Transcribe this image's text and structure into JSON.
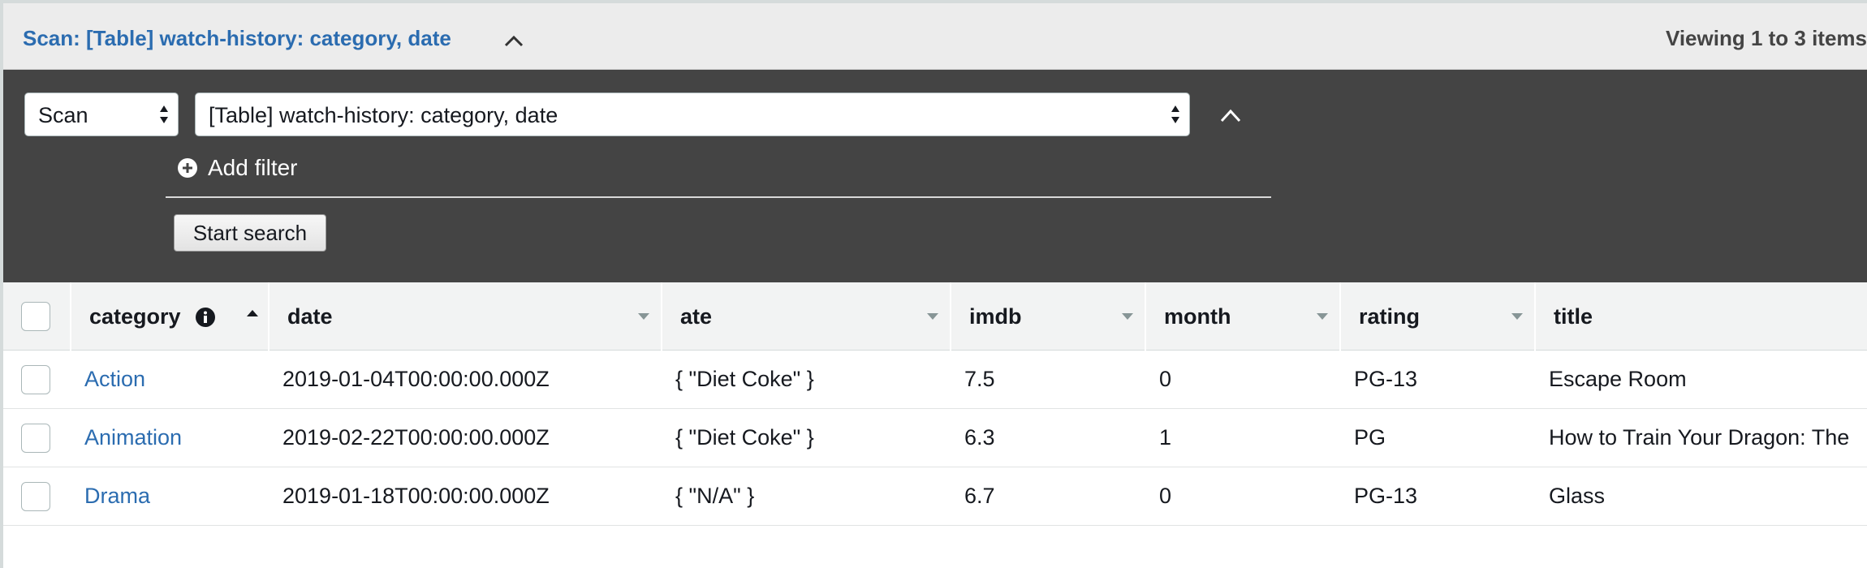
{
  "header": {
    "title": "Scan: [Table] watch-history: category, date",
    "viewing": "Viewing 1 to 3 items"
  },
  "panel": {
    "mode_select": "Scan",
    "table_select": "[Table] watch-history: category, date",
    "add_filter": "Add filter",
    "start_search": "Start search"
  },
  "table": {
    "columns": [
      "category",
      "date",
      "ate",
      "imdb",
      "month",
      "rating",
      "title"
    ],
    "rows": [
      {
        "category": "Action",
        "date": "2019-01-04T00:00:00.000Z",
        "ate": "{ \"Diet Coke\" }",
        "imdb": "7.5",
        "month": "0",
        "rating": "PG-13",
        "title": "Escape Room"
      },
      {
        "category": "Animation",
        "date": "2019-02-22T00:00:00.000Z",
        "ate": "{ \"Diet Coke\" }",
        "imdb": "6.3",
        "month": "1",
        "rating": "PG",
        "title": "How to Train Your Dragon: The"
      },
      {
        "category": "Drama",
        "date": "2019-01-18T00:00:00.000Z",
        "ate": "{ \"N/A\" }",
        "imdb": "6.7",
        "month": "0",
        "rating": "PG-13",
        "title": "Glass"
      }
    ]
  },
  "colors": {
    "link": "#2b6cb0",
    "panel_bg": "#444444",
    "header_bg": "#ececec",
    "table_header_bg": "#f2f3f3"
  },
  "icons": {
    "header_collapse": "chevron-up-icon",
    "panel_collapse": "chevron-up-icon",
    "add_filter": "plus-circle-icon",
    "column_info": "info-icon",
    "sort_ascending": "sort-ascending-icon",
    "sort_menu": "caret-down-icon",
    "select_caret": "select-caret-icon"
  }
}
